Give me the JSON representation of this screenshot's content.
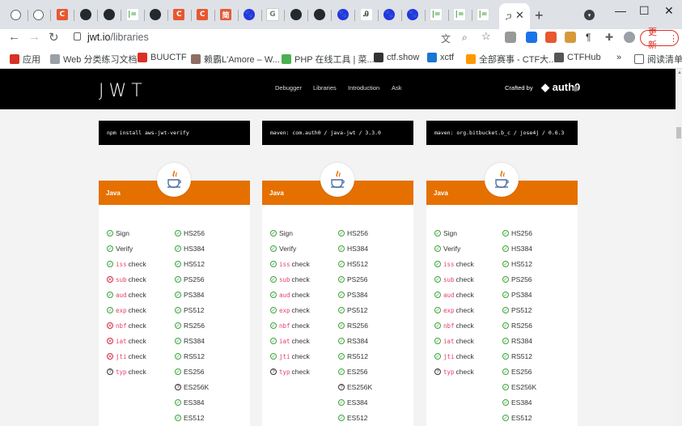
{
  "browser": {
    "tabs": [
      {
        "favicon": "globe-icon",
        "letter": ""
      },
      {
        "favicon": "globe-icon",
        "letter": ""
      },
      {
        "favicon": "csdn-icon",
        "letter": "C"
      },
      {
        "favicon": "github-icon",
        "letter": ""
      },
      {
        "favicon": "github-icon",
        "letter": ""
      },
      {
        "favicon": "leetcode-icon",
        "letter": "|="
      },
      {
        "favicon": "github-icon",
        "letter": ""
      },
      {
        "favicon": "csdn-icon",
        "letter": "C"
      },
      {
        "favicon": "csdn-icon",
        "letter": "C"
      },
      {
        "favicon": "jianshu-icon",
        "letter": "简"
      },
      {
        "favicon": "baidu-icon",
        "letter": "🐾"
      },
      {
        "favicon": "google-icon",
        "letter": "G"
      },
      {
        "favicon": "github-icon",
        "letter": ""
      },
      {
        "favicon": "github-icon",
        "letter": ""
      },
      {
        "favicon": "baidu-icon",
        "letter": "🐾"
      },
      {
        "favicon": "ae-icon",
        "letter": "Ꭿ"
      },
      {
        "favicon": "baidu-icon",
        "letter": "🐾"
      },
      {
        "favicon": "baidu-icon",
        "letter": "🐾"
      },
      {
        "favicon": "leetcode-icon",
        "letter": "|="
      },
      {
        "favicon": "leetcode-icon",
        "letter": "|="
      },
      {
        "favicon": "leetcode-icon",
        "letter": "|="
      }
    ],
    "active_tab": {
      "title": "ጋ",
      "close": "✕"
    },
    "new_tab": "+",
    "window": {
      "minimize": "—",
      "maximize": "☐",
      "close": "✕"
    },
    "url_host": "jwt.io",
    "url_path": "/libraries",
    "update_label": "更新",
    "bookmarks": [
      {
        "label": "应用",
        "color": "#d93025"
      },
      {
        "label": "Web 分类练习文档",
        "color": "#9aa0a6"
      },
      {
        "label": "BUUCTF",
        "color": "#d93025"
      },
      {
        "label": "赖霸L'Amore – W...",
        "color": "#8d6e63"
      },
      {
        "label": "PHP 在线工具 | 菜...",
        "color": "#4caf50"
      },
      {
        "label": "ctf.show",
        "color": "#333333"
      },
      {
        "label": "xctf",
        "color": "#1976d2"
      },
      {
        "label": "全部赛事 - CTF大...",
        "color": "#ff9800"
      },
      {
        "label": "CTFHub",
        "color": "#555555"
      }
    ],
    "bookmarks_more": "»",
    "reading_list": "阅读清单"
  },
  "site": {
    "logo": "JWT",
    "nav": [
      "Debugger",
      "Libraries",
      "Introduction",
      "Ask"
    ],
    "crafted_by": "Crafted by",
    "auth0": "auth0"
  },
  "install_commands": [
    "npm install aws-jwt-verify",
    "maven: com.auth0 / java-jwt / 3.3.0",
    "maven: org.bitbucket.b_c / jose4j / 0.6.3"
  ],
  "libraries": [
    {
      "language": "Java",
      "checks": [
        {
          "claim": "",
          "label": "Sign",
          "status": "ok"
        },
        {
          "claim": "",
          "label": "Verify",
          "status": "ok"
        },
        {
          "claim": "iss",
          "label": "check",
          "status": "ok"
        },
        {
          "claim": "sub",
          "label": "check",
          "status": "no"
        },
        {
          "claim": "aud",
          "label": "check",
          "status": "ok"
        },
        {
          "claim": "exp",
          "label": "check",
          "status": "ok"
        },
        {
          "claim": "nbf",
          "label": "check",
          "status": "no"
        },
        {
          "claim": "iat",
          "label": "check",
          "status": "no"
        },
        {
          "claim": "jti",
          "label": "check",
          "status": "no"
        },
        {
          "claim": "typ",
          "label": "check",
          "status": "q"
        }
      ],
      "algorithms": [
        {
          "name": "HS256",
          "status": "ok"
        },
        {
          "name": "HS384",
          "status": "ok"
        },
        {
          "name": "HS512",
          "status": "ok"
        },
        {
          "name": "PS256",
          "status": "ok"
        },
        {
          "name": "PS384",
          "status": "ok"
        },
        {
          "name": "PS512",
          "status": "ok"
        },
        {
          "name": "RS256",
          "status": "ok"
        },
        {
          "name": "RS384",
          "status": "ok"
        },
        {
          "name": "RS512",
          "status": "ok"
        },
        {
          "name": "ES256",
          "status": "ok"
        },
        {
          "name": "ES256K",
          "status": "q"
        },
        {
          "name": "ES384",
          "status": "ok"
        },
        {
          "name": "ES512",
          "status": "ok"
        }
      ]
    },
    {
      "language": "Java",
      "checks": [
        {
          "claim": "",
          "label": "Sign",
          "status": "ok"
        },
        {
          "claim": "",
          "label": "Verify",
          "status": "ok"
        },
        {
          "claim": "iss",
          "label": "check",
          "status": "ok"
        },
        {
          "claim": "sub",
          "label": "check",
          "status": "ok"
        },
        {
          "claim": "aud",
          "label": "check",
          "status": "ok"
        },
        {
          "claim": "exp",
          "label": "check",
          "status": "ok"
        },
        {
          "claim": "nbf",
          "label": "check",
          "status": "ok"
        },
        {
          "claim": "iat",
          "label": "check",
          "status": "ok"
        },
        {
          "claim": "jti",
          "label": "check",
          "status": "ok"
        },
        {
          "claim": "typ",
          "label": "check",
          "status": "q"
        }
      ],
      "algorithms": [
        {
          "name": "HS256",
          "status": "ok"
        },
        {
          "name": "HS384",
          "status": "ok"
        },
        {
          "name": "HS512",
          "status": "ok"
        },
        {
          "name": "PS256",
          "status": "ok"
        },
        {
          "name": "PS384",
          "status": "ok"
        },
        {
          "name": "PS512",
          "status": "ok"
        },
        {
          "name": "RS256",
          "status": "ok"
        },
        {
          "name": "RS384",
          "status": "ok"
        },
        {
          "name": "RS512",
          "status": "ok"
        },
        {
          "name": "ES256",
          "status": "ok"
        },
        {
          "name": "ES256K",
          "status": "q"
        },
        {
          "name": "ES384",
          "status": "ok"
        },
        {
          "name": "ES512",
          "status": "ok"
        }
      ]
    },
    {
      "language": "Java",
      "checks": [
        {
          "claim": "",
          "label": "Sign",
          "status": "ok"
        },
        {
          "claim": "",
          "label": "Verify",
          "status": "ok"
        },
        {
          "claim": "iss",
          "label": "check",
          "status": "ok"
        },
        {
          "claim": "sub",
          "label": "check",
          "status": "ok"
        },
        {
          "claim": "aud",
          "label": "check",
          "status": "ok"
        },
        {
          "claim": "exp",
          "label": "check",
          "status": "ok"
        },
        {
          "claim": "nbf",
          "label": "check",
          "status": "ok"
        },
        {
          "claim": "iat",
          "label": "check",
          "status": "ok"
        },
        {
          "claim": "jti",
          "label": "check",
          "status": "ok"
        },
        {
          "claim": "typ",
          "label": "check",
          "status": "q"
        }
      ],
      "algorithms": [
        {
          "name": "HS256",
          "status": "ok"
        },
        {
          "name": "HS384",
          "status": "ok"
        },
        {
          "name": "HS512",
          "status": "ok"
        },
        {
          "name": "PS256",
          "status": "ok"
        },
        {
          "name": "PS384",
          "status": "ok"
        },
        {
          "name": "PS512",
          "status": "ok"
        },
        {
          "name": "RS256",
          "status": "ok"
        },
        {
          "name": "RS384",
          "status": "ok"
        },
        {
          "name": "RS512",
          "status": "ok"
        },
        {
          "name": "ES256",
          "status": "ok"
        },
        {
          "name": "ES256K",
          "status": "ok"
        },
        {
          "name": "ES384",
          "status": "ok"
        },
        {
          "name": "ES512",
          "status": "ok"
        }
      ]
    }
  ],
  "colors": {
    "accent": "#e57000",
    "ok": "#3aa43a",
    "no": "#d12b3a",
    "claim": "#e83e6c"
  }
}
